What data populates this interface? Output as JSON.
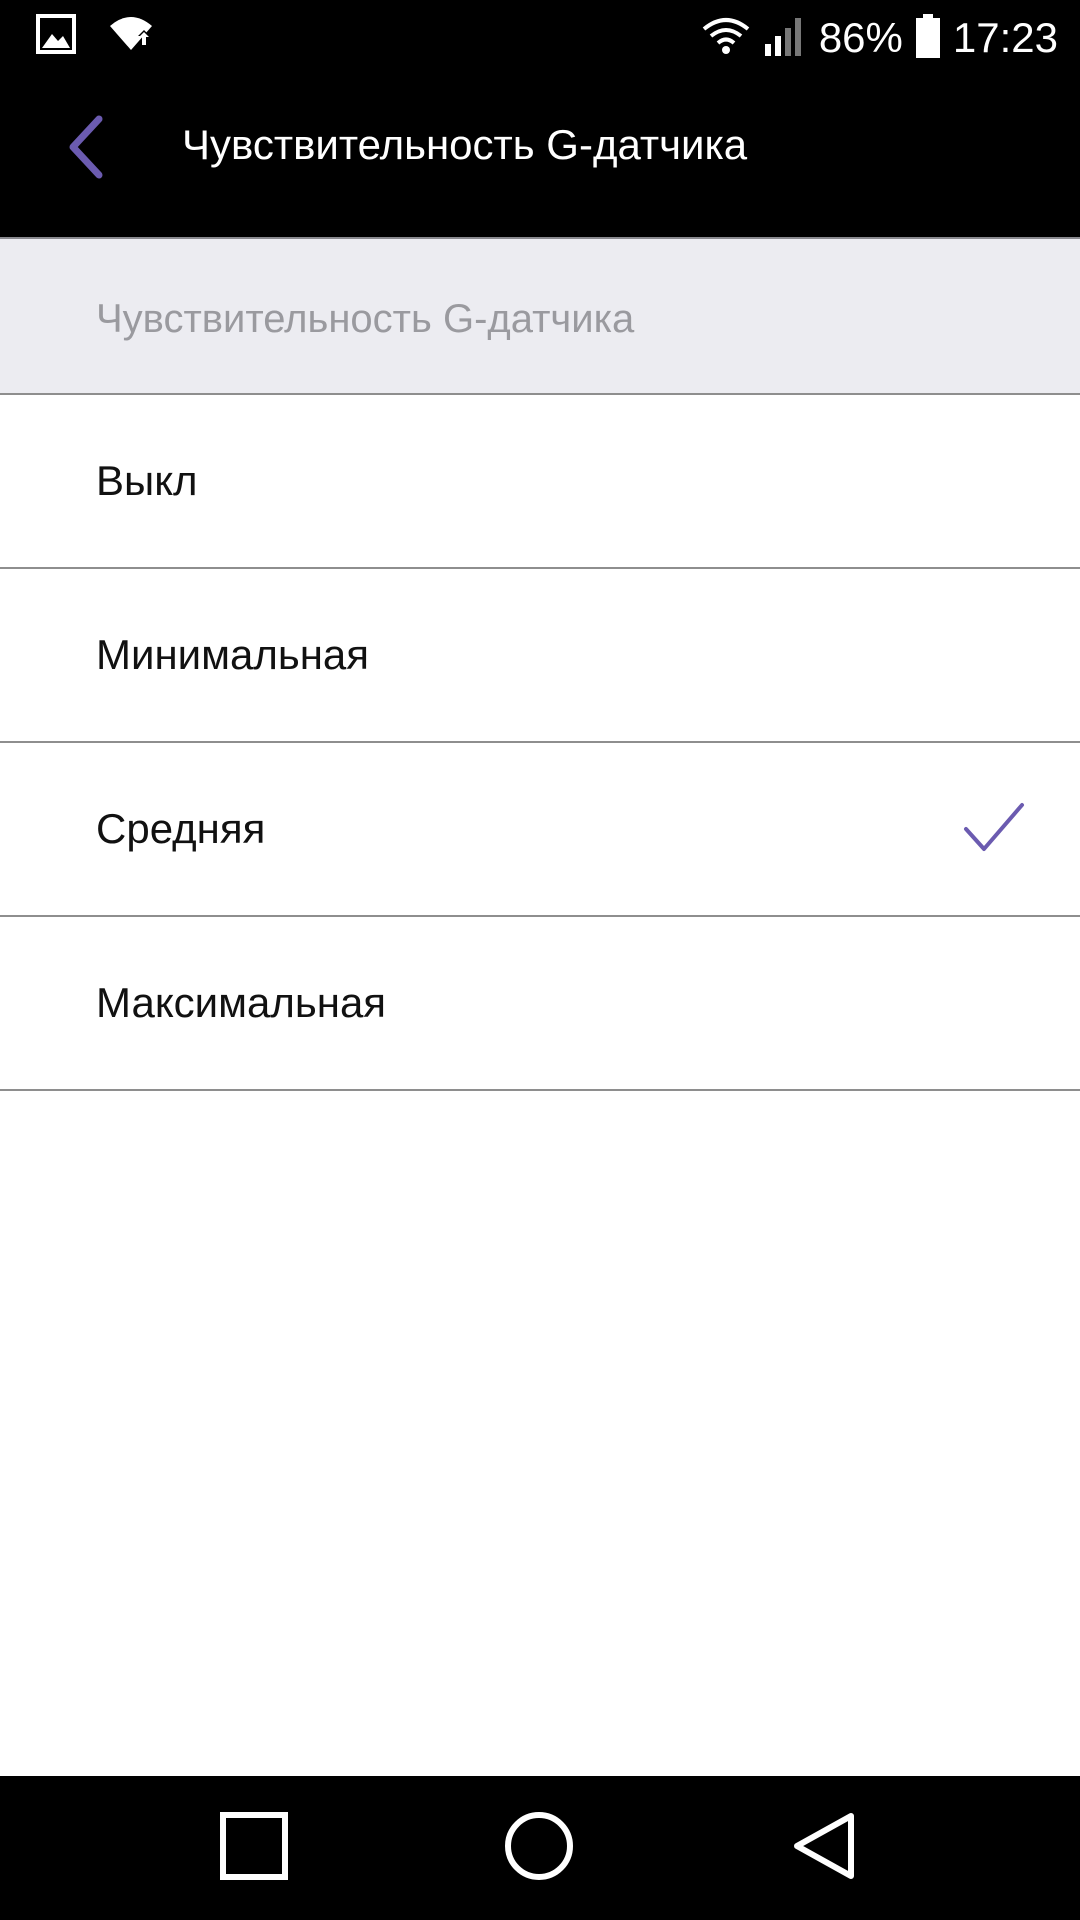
{
  "status_bar": {
    "icons_left": [
      "gallery-icon",
      "wifi-upload-icon"
    ],
    "battery_percent": "86%",
    "time": "17:23"
  },
  "app_bar": {
    "title": "Чувствительность G-датчика",
    "back_icon": "chevron-left-icon"
  },
  "section": {
    "header": "Чувствительность G-датчика"
  },
  "options": [
    {
      "label": "Выкл",
      "selected": false
    },
    {
      "label": "Минимальная",
      "selected": false
    },
    {
      "label": "Средняя",
      "selected": true
    },
    {
      "label": "Максимальная",
      "selected": false
    }
  ],
  "nav_bar": {
    "icons": [
      "recents-square-icon",
      "home-circle-icon",
      "back-triangle-icon"
    ]
  },
  "colors": {
    "accent": "#6b5bb0",
    "header_bg": "#ececf1"
  }
}
